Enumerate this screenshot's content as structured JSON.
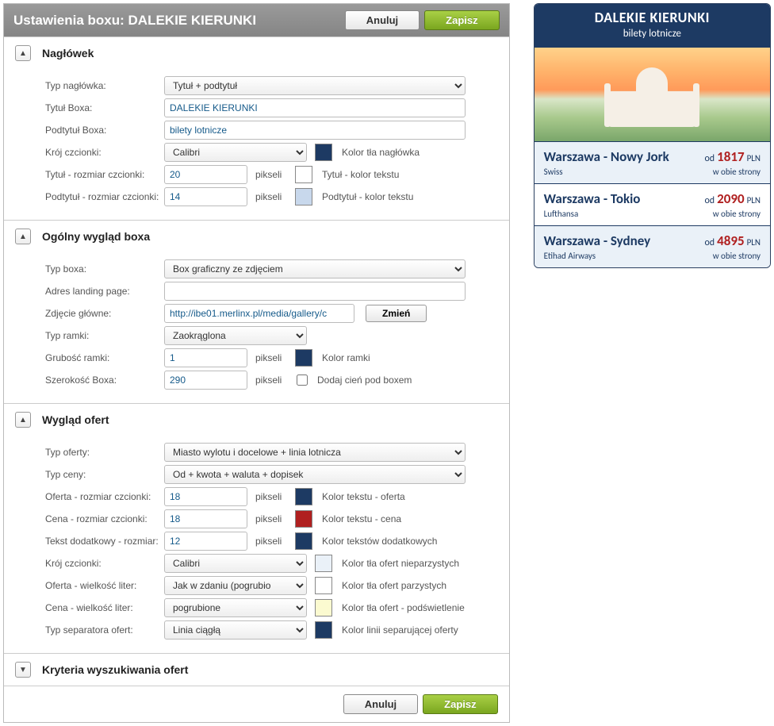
{
  "header": {
    "title_prefix": "Ustawienia boxu: ",
    "title_box": "DALEKIE KIERUNKI",
    "cancel": "Anuluj",
    "save": "Zapisz"
  },
  "sections": {
    "naglowek": {
      "title": "Nagłówek",
      "typ_naglowka_lbl": "Typ nagłówka:",
      "typ_naglowka_val": "Tytuł + podtytuł",
      "tytul_lbl": "Tytuł Boxa:",
      "tytul_val": "DALEKIE KIERUNKI",
      "podtytul_lbl": "Podtytuł Boxa:",
      "podtytul_val": "bilety lotnicze",
      "kroj_lbl": "Krój czcionki:",
      "kroj_val": "Calibri",
      "bg_header_lbl": "Kolor tła nagłówka",
      "tytul_size_lbl": "Tytuł - rozmiar czcionki:",
      "tytul_size_val": "20",
      "tytul_color_lbl": "Tytuł - kolor tekstu",
      "podtytul_size_lbl": "Podtytuł - rozmiar czcionki:",
      "podtytul_size_val": "14",
      "podtytul_color_lbl": "Podtytuł - kolor tekstu",
      "px": "pikseli"
    },
    "wyglad": {
      "title": "Ogólny wygląd boxa",
      "typ_boxa_lbl": "Typ boxa:",
      "typ_boxa_val": "Box graficzny ze zdjęciem",
      "landing_lbl": "Adres landing page:",
      "landing_val": "",
      "zdjecie_lbl": "Zdjęcie główne:",
      "zdjecie_val": "http://ibe01.merlinx.pl/media/gallery/c",
      "zmien": "Zmień",
      "typ_ramki_lbl": "Typ ramki:",
      "typ_ramki_val": "Zaokrąglona",
      "grubosc_lbl": "Grubość ramki:",
      "grubosc_val": "1",
      "ramka_color_lbl": "Kolor ramki",
      "szer_lbl": "Szerokość Boxa:",
      "szer_val": "290",
      "cien_lbl": "Dodaj cień pod boxem",
      "px": "pikseli"
    },
    "ofert": {
      "title": "Wygląd ofert",
      "typ_oferty_lbl": "Typ oferty:",
      "typ_oferty_val": "Miasto wylotu i docelowe + linia lotnicza",
      "typ_ceny_lbl": "Typ ceny:",
      "typ_ceny_val": "Od + kwota + waluta + dopisek",
      "oferta_size_lbl": "Oferta - rozmiar czcionki:",
      "oferta_size_val": "18",
      "oferta_color_lbl": "Kolor tekstu - oferta",
      "cena_size_lbl": "Cena - rozmiar czcionki:",
      "cena_size_val": "18",
      "cena_color_lbl": "Kolor tekstu - cena",
      "dod_size_lbl": "Tekst dodatkowy - rozmiar:",
      "dod_size_val": "12",
      "dod_color_lbl": "Kolor tekstów dodatkowych",
      "kroj_lbl": "Krój czcionki:",
      "kroj_val": "Calibri",
      "bg_odd_lbl": "Kolor tła ofert nieparzystych",
      "litery_lbl": "Oferta - wielkość liter:",
      "litery_val": "Jak w zdaniu (pogrubio",
      "bg_even_lbl": "Kolor tła ofert parzystych",
      "cena_litery_lbl": "Cena - wielkość liter:",
      "cena_litery_val": "pogrubione",
      "bg_highlight_lbl": "Kolor tła ofert - podświetlenie",
      "sep_lbl": "Typ separatora ofert:",
      "sep_val": "Linia ciągłą",
      "sep_color_lbl": "Kolor linii separującej oferty",
      "px": "pikseli"
    },
    "kryteria": {
      "title": "Kryteria wyszukiwania ofert"
    }
  },
  "colors": {
    "header_bg": "#1d3a63",
    "title_color": "#ffffff",
    "subtitle_color": "#c8d8ec",
    "ramka": "#1d3a63",
    "oferta": "#1d3a63",
    "cena": "#b02020",
    "dodatkowy": "#1d3a63",
    "odd": "#eaf1f8",
    "even": "#ffffff",
    "highlight": "#fbfad0",
    "sep": "#1d3a63"
  },
  "preview": {
    "title": "DALEKIE KIERUNKI",
    "subtitle": "bilety lotnicze",
    "od": "od",
    "currency": "PLN",
    "note": "w obie strony",
    "offers": [
      {
        "route": "Warszawa - Nowy Jork",
        "airline": "Swiss",
        "price": "1817"
      },
      {
        "route": "Warszawa - Tokio",
        "airline": "Lufthansa",
        "price": "2090"
      },
      {
        "route": "Warszawa - Sydney",
        "airline": "Etihad Airways",
        "price": "4895"
      }
    ]
  }
}
